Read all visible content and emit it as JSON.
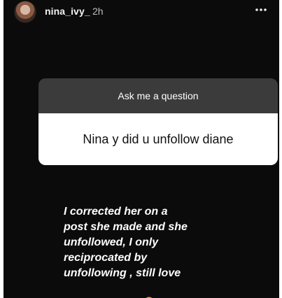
{
  "story": {
    "header": {
      "username": "nina_ivy_",
      "time": "2h",
      "more_icon": "more-horizontal-icon"
    },
    "question_sticker": {
      "title": "Ask me a question",
      "answer": "Nina y did u unfollow diane"
    },
    "reply": {
      "text": "I corrected her on a\npost she made and she\nunfollowed, I only\nreciprocated by\nunfollowing , still love\nher regardless",
      "emoji_icon": "smiling-face-with-hearts-icon"
    }
  }
}
